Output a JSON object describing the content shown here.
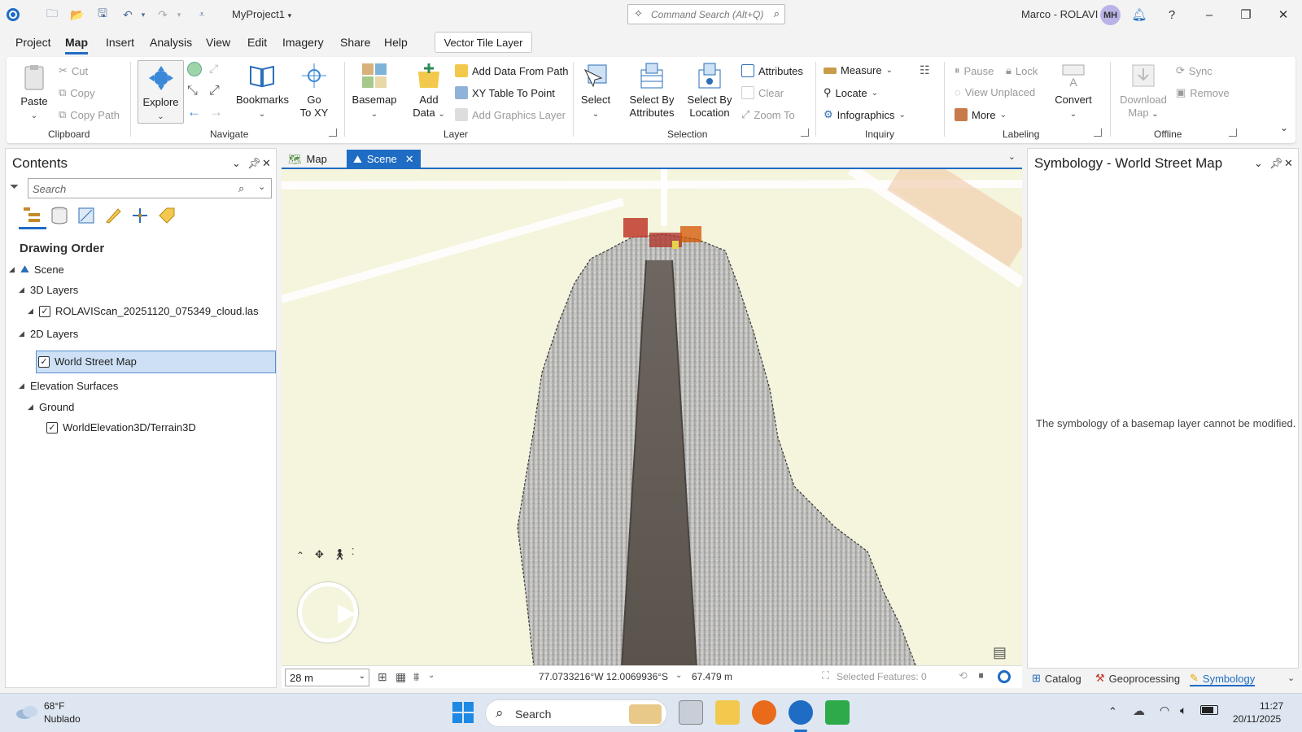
{
  "window": {
    "project_title": "MyProject1",
    "command_search_placeholder": "Command Search (Alt+Q)",
    "user_name": "Marco - ROLAVI",
    "user_initials": "MH"
  },
  "menu": {
    "items": [
      "Project",
      "Map",
      "Insert",
      "Analysis",
      "View",
      "Edit",
      "Imagery",
      "Share",
      "Help"
    ],
    "active": "Map",
    "context_tab": "Vector Tile Layer"
  },
  "ribbon": {
    "clipboard": {
      "paste": "Paste",
      "cut": "Cut",
      "copy": "Copy",
      "copy_path": "Copy Path",
      "label": "Clipboard"
    },
    "navigate": {
      "explore": "Explore",
      "bookmarks": "Bookmarks",
      "go_to_xy": [
        "Go",
        "To XY"
      ],
      "label": "Navigate"
    },
    "layer": {
      "basemap": "Basemap",
      "add_data": [
        "Add",
        "Data"
      ],
      "add_data_from_path": "Add Data From Path",
      "xy_table": "XY Table To Point",
      "add_graphics": "Add Graphics Layer",
      "label": "Layer"
    },
    "selection": {
      "select": "Select",
      "select_by_attributes": [
        "Select By",
        "Attributes"
      ],
      "select_by_location": [
        "Select By",
        "Location"
      ],
      "attributes": "Attributes",
      "clear": "Clear",
      "zoom_to": "Zoom To",
      "label": "Selection"
    },
    "inquiry": {
      "measure": "Measure",
      "locate": "Locate",
      "infographics": "Infographics",
      "label": "Inquiry"
    },
    "labeling": {
      "pause": "Pause",
      "lock": "Lock",
      "view_unplaced": "View Unplaced",
      "more": "More",
      "convert": "Convert",
      "label": "Labeling"
    },
    "offline": {
      "download_map": [
        "Download",
        "Map"
      ],
      "sync": "Sync",
      "remove": "Remove",
      "label": "Offline"
    }
  },
  "contents": {
    "title": "Contents",
    "search_placeholder": "Search",
    "drawing_order": "Drawing Order",
    "scene": "Scene",
    "layers_3d": "3D Layers",
    "las_layer": "ROLAVIScan_20251120_075349_cloud.las",
    "layers_2d": "2D Layers",
    "world_street_map": "World Street Map",
    "elevation_surfaces": "Elevation Surfaces",
    "ground": "Ground",
    "terrain": "WorldElevation3D/Terrain3D"
  },
  "view": {
    "tabs": [
      "Map",
      "Scene"
    ],
    "active_tab": "Scene",
    "scale": "28 m",
    "coordinates": "77.0733216°W 12.0069936°S",
    "elevation": "67.479 m",
    "selected_features": "Selected Features: 0"
  },
  "symbology": {
    "title": "Symbology - World Street Map",
    "message": "The symbology of a basemap layer cannot be modified."
  },
  "bottom_tabs": [
    "Catalog",
    "Geoprocessing",
    "Symbology"
  ],
  "taskbar": {
    "temp": "68°F",
    "condition": "Nublado",
    "search": "Search",
    "time": "11:27",
    "date": "20/11/2025"
  },
  "colors": {
    "accent": "#1f6cc4",
    "selection": "#cde0f5",
    "map_bg": "#f5f4dc"
  }
}
